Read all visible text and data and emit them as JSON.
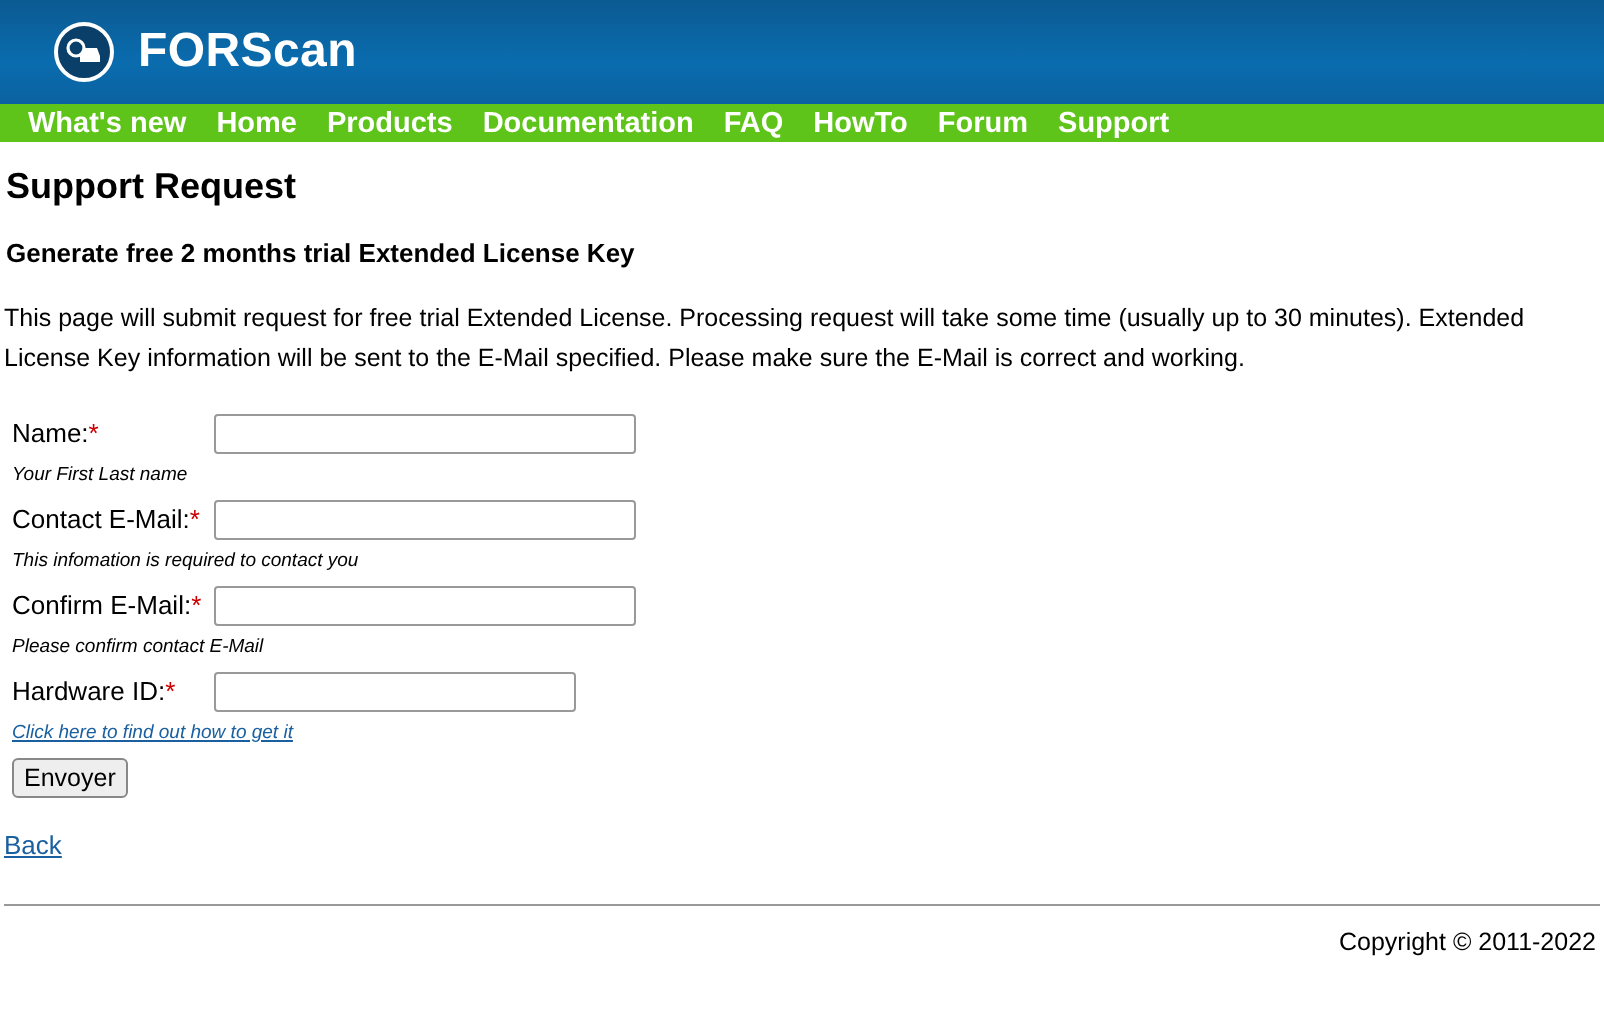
{
  "header": {
    "logo_text": "FORScan"
  },
  "nav": [
    "What's new",
    "Home",
    "Products",
    "Documentation",
    "FAQ",
    "HowTo",
    "Forum",
    "Support"
  ],
  "title": "Support Request",
  "subtitle": "Generate free 2 months trial Extended License Key",
  "intro": "This page will submit request for free trial Extended License. Processing request will take some time (usually up to 30 minutes). Extended License Key information will be sent to the E-Mail specified. Please make sure the E-Mail is correct and working.",
  "fields": [
    {
      "label": "Name:",
      "required_mark": "*",
      "hint": "Your First Last name",
      "kind": "note"
    },
    {
      "label": "Contact E-Mail:",
      "required_mark": "*",
      "hint": "This infomation is required to contact you",
      "kind": "note"
    },
    {
      "label": "Confirm E-Mail:",
      "required_mark": "*",
      "hint": "Please confirm contact E-Mail",
      "kind": "note"
    },
    {
      "label": "Hardware ID:",
      "required_mark": "*",
      "hint": "Click here to find out how to get it",
      "kind": "link"
    }
  ],
  "submit_button": "Envoyer",
  "back_link": "Back",
  "footer": "Copyright © 2011-2022"
}
